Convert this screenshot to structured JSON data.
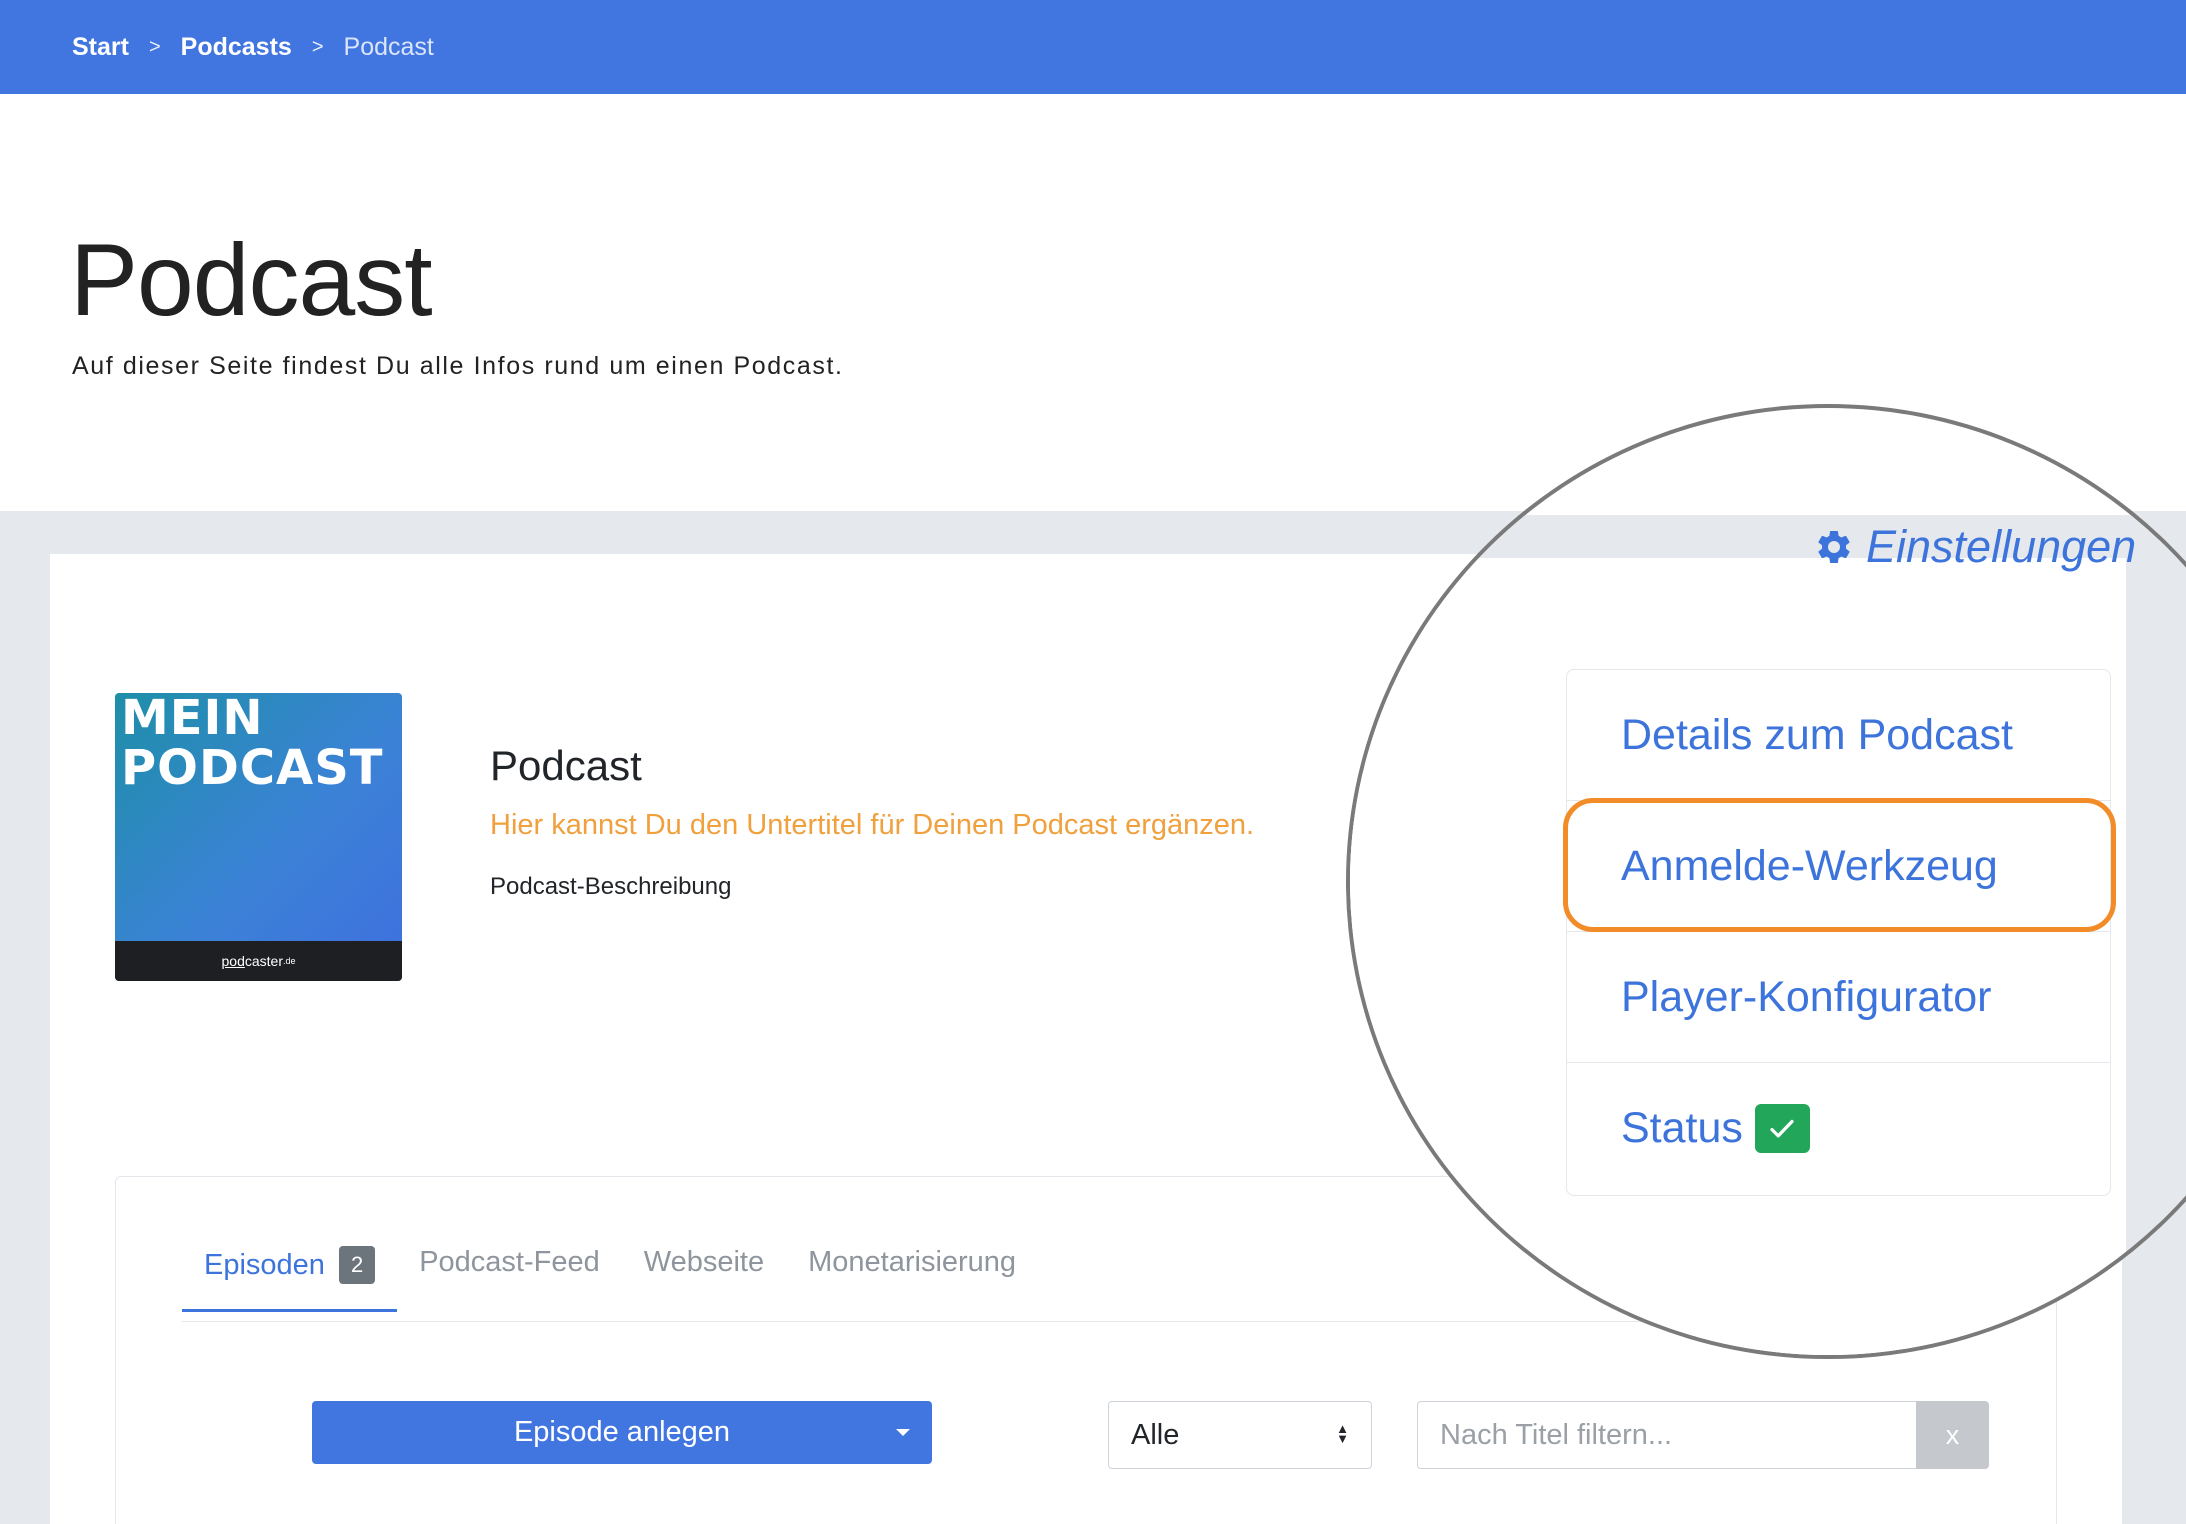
{
  "breadcrumb": {
    "items": [
      "Start",
      "Podcasts",
      "Podcast"
    ],
    "separator": ">"
  },
  "hero": {
    "title": "Podcast",
    "subtitle": "Auf dieser Seite findest Du alle Infos rund um einen Podcast."
  },
  "podcast": {
    "cover_title_line1": "MEIN",
    "cover_title_line2": "PODCAST",
    "cover_brand_pod": "pod",
    "cover_brand_rest": "caster",
    "cover_brand_tld": ".de",
    "name": "Podcast",
    "subtitle": "Hier kannst Du den Untertitel für Deinen Podcast ergänzen.",
    "description": "Podcast-Beschreibung"
  },
  "settings": {
    "label": "Einstellungen",
    "icon": "gear-icon"
  },
  "menu": {
    "items": [
      {
        "label": "Details zum Podcast"
      },
      {
        "label": "Anmelde-Werkzeug",
        "highlighted": true
      },
      {
        "label": "Player-Konfigurator"
      },
      {
        "label": "Status",
        "status_icon": "check-icon"
      }
    ]
  },
  "tabs": [
    {
      "label": "Episoden",
      "badge": "2",
      "active": true
    },
    {
      "label": "Podcast-Feed"
    },
    {
      "label": "Webseite"
    },
    {
      "label": "Monetarisierung"
    }
  ],
  "episodes": {
    "create_button": "Episode anlegen",
    "filter_select": "Alle",
    "search_placeholder": "Nach Titel filtern...",
    "clear_button": "x"
  },
  "colors": {
    "primary": "#4176e0",
    "link": "#3d74dc",
    "subtitle": "#f0a03d",
    "highlight": "#f28c28",
    "status_ok": "#22a65a"
  }
}
